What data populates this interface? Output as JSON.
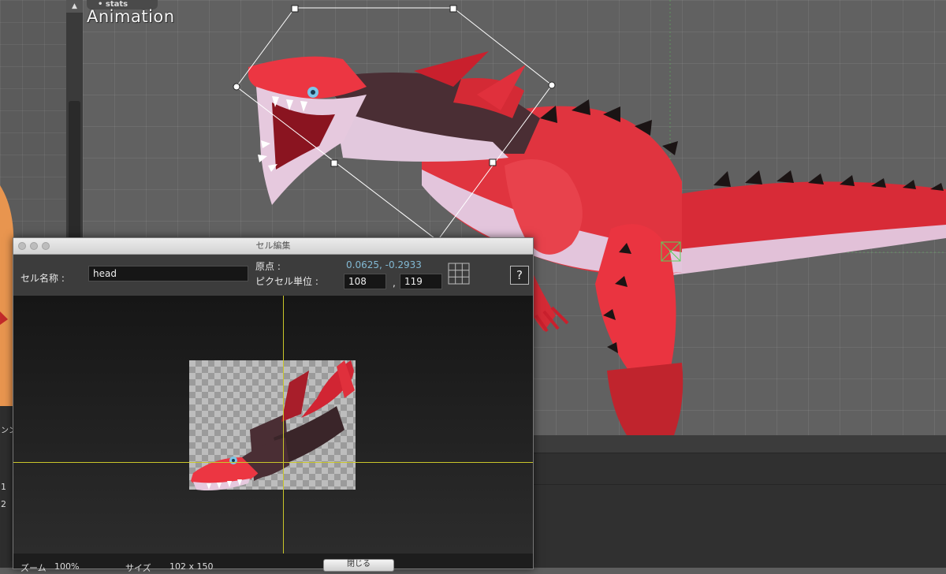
{
  "header": {
    "stats_tab": "stats",
    "title": "Animation"
  },
  "dialog": {
    "title": "セル編集",
    "cell_name_label": "セル名称 :",
    "cell_name_value": "head",
    "origin_label": "原点 :",
    "origin_value": "0.0625, -0.2933",
    "pixel_label": "ピクセル単位 :",
    "pixel_x": "108",
    "pixel_sep": ",",
    "pixel_y": "119",
    "help_label": "?",
    "zoom_label": "ズーム",
    "zoom_value": "100%",
    "size_label": "サイズ",
    "size_value": "102 x 150",
    "ok_label": "閉じる"
  },
  "left_panel": {
    "num_a": "1",
    "num_b": "2",
    "tab_label": "ンン"
  },
  "colors": {
    "dragon_red": "#e8323e",
    "dragon_dark": "#4a2e34",
    "belly": "#e3c8de",
    "spike": "#1a1414",
    "crosshair": "#c9c62a",
    "origin_text": "#82b9d4"
  }
}
